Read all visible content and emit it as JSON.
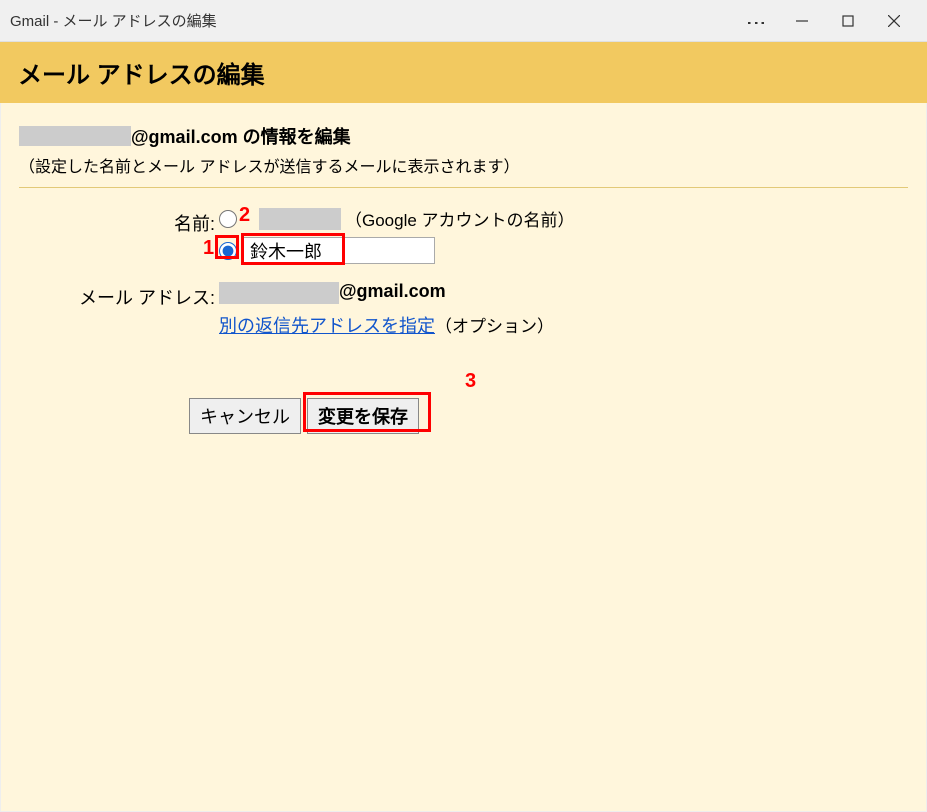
{
  "window": {
    "title": "Gmail - メール アドレスの編集"
  },
  "header": {
    "title": "メール アドレスの編集"
  },
  "info": {
    "suffix": "@gmail.com の情報を編集",
    "subtitle": "（設定した名前とメール アドレスが送信するメールに表示されます）"
  },
  "form": {
    "name_label": "名前:",
    "google_note": "（Google アカウントの名前）",
    "custom_name_value": "鈴木一郎",
    "email_label": "メール アドレス:",
    "email_suffix": "@gmail.com",
    "reply_link": "別の返信先アドレスを指定",
    "option_note": "（オプション）"
  },
  "buttons": {
    "cancel": "キャンセル",
    "save": "変更を保存"
  },
  "annotations": {
    "n1": "1",
    "n2": "2",
    "n3": "3"
  }
}
